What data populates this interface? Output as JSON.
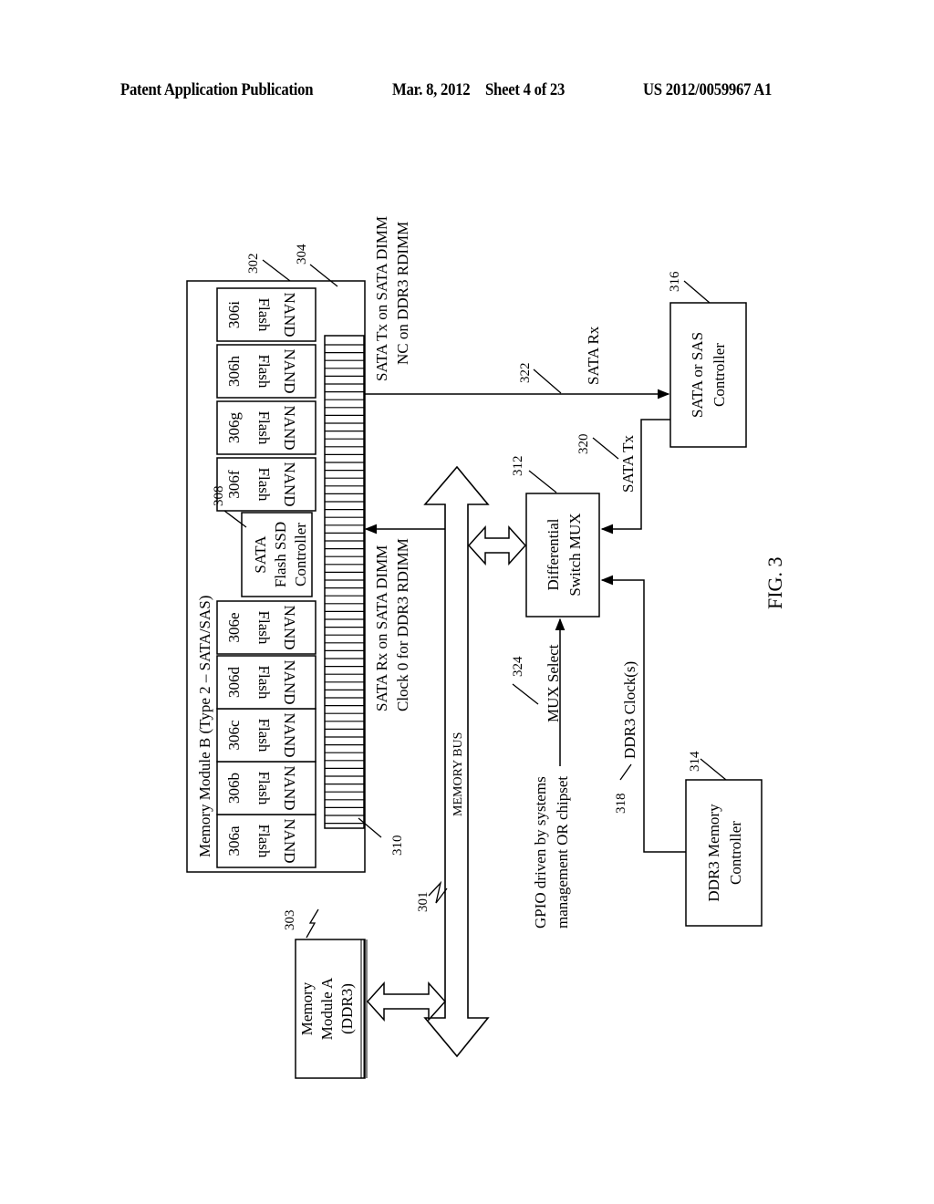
{
  "header": {
    "publication_label": "Patent Application Publication",
    "date": "Mar. 8, 2012",
    "sheet": "Sheet 4 of 23",
    "publication_number": "US 2012/0059967 A1"
  },
  "figure": {
    "caption": "FIG. 3",
    "memory_module_b": {
      "ref": "302",
      "title": "Memory Module B (Type 2 – SATA/SAS)",
      "edge_ref": "304",
      "connector_ref": "310",
      "nand_chips": [
        {
          "ref": "306a",
          "line1": "NAND",
          "line2": "Flash"
        },
        {
          "ref": "306b",
          "line1": "NAND",
          "line2": "Flash"
        },
        {
          "ref": "306c",
          "line1": "NAND",
          "line2": "Flash"
        },
        {
          "ref": "306d",
          "line1": "NAND",
          "line2": "Flash"
        },
        {
          "ref": "306e",
          "line1": "NAND",
          "line2": "Flash"
        },
        {
          "ref": "306f",
          "line1": "NAND",
          "line2": "Flash"
        },
        {
          "ref": "306g",
          "line1": "NAND",
          "line2": "Flash"
        },
        {
          "ref": "306h",
          "line1": "NAND",
          "line2": "Flash"
        },
        {
          "ref": "306i",
          "line1": "NAND",
          "line2": "Flash"
        }
      ],
      "ssd_controller": {
        "ref": "308",
        "line1": "SATA",
        "line2": "Flash SSD",
        "line3": "Controller"
      }
    },
    "memory_module_a": {
      "ref": "303",
      "line1": "Memory",
      "line2": "Module A",
      "line3": "(DDR3)"
    },
    "memory_bus": {
      "ref": "301",
      "label": "MEMORY BUS"
    },
    "mux": {
      "ref": "312",
      "line1": "Differential",
      "line2": "Switch MUX"
    },
    "ddr3_controller": {
      "ref": "314",
      "line1": "DDR3 Memory",
      "line2": "Controller"
    },
    "sata_controller": {
      "ref": "316",
      "line1": "SATA or SAS",
      "line2": "Controller"
    },
    "signals": {
      "sata_tx_note_1": "SATA Tx on SATA DIMM",
      "sata_tx_note_2": "NC on DDR3 RDIMM",
      "sata_rx_note_1": "SATA Rx on SATA DIMM",
      "sata_rx_note_2": "Clock 0 for DDR3 RDIMM",
      "sata_rx": {
        "ref": "322",
        "label": "SATA Rx"
      },
      "sata_tx": {
        "ref": "320",
        "label": "SATA Tx"
      },
      "mux_select": {
        "ref": "324",
        "label": "MUX Select"
      },
      "gpio_1": "GPIO driven by systems",
      "gpio_2": "management OR chipset",
      "ddr3_clock": {
        "ref": "318",
        "label": "DDR3 Clock(s)"
      }
    }
  }
}
